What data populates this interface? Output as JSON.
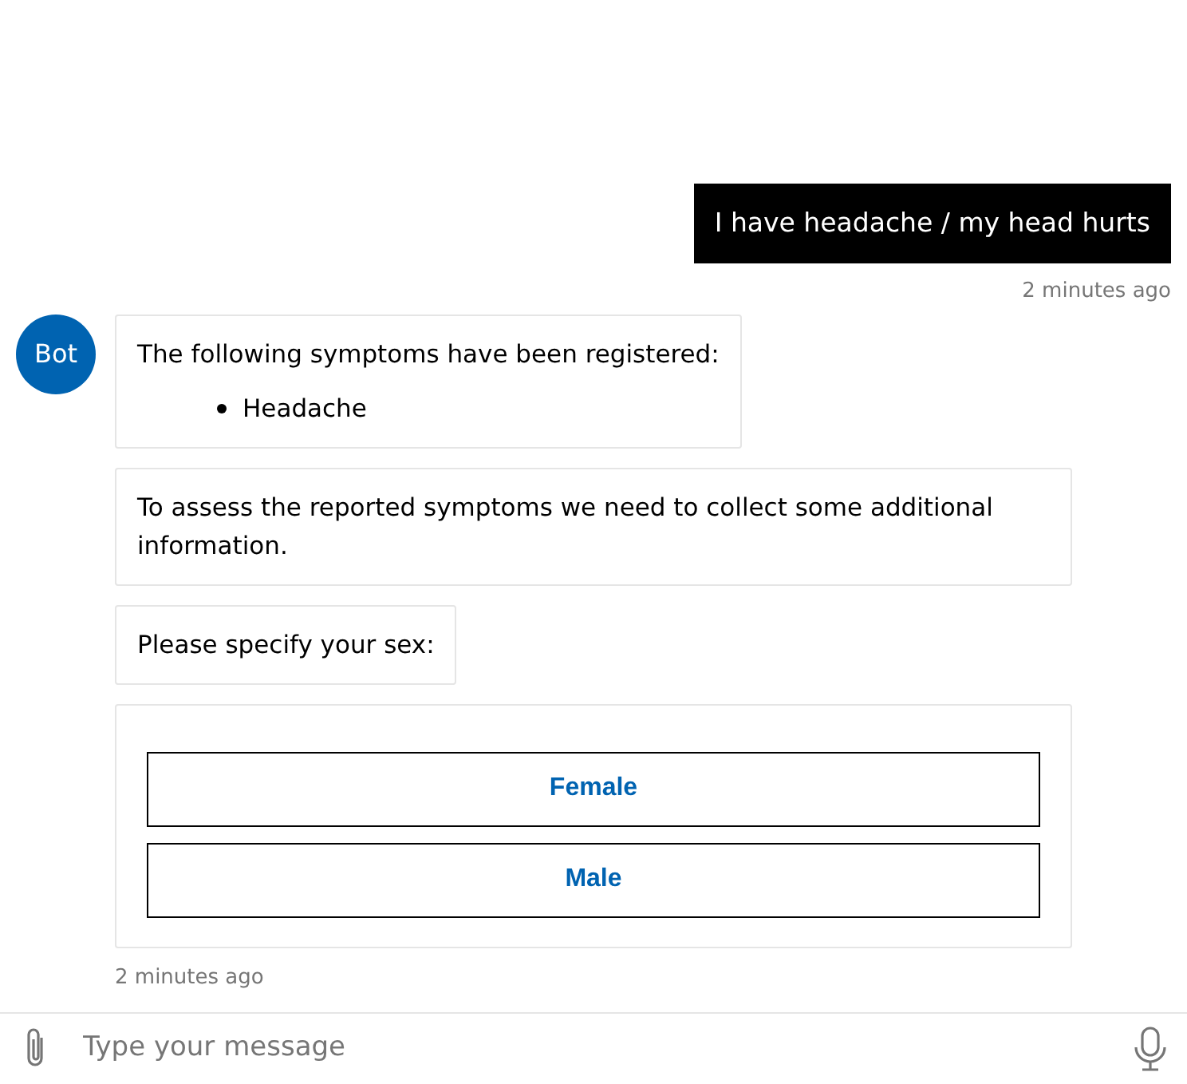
{
  "user_message": {
    "text": "I have headache / my head hurts",
    "timestamp": "2 minutes ago"
  },
  "bot": {
    "avatar_label": "Bot",
    "messages": [
      {
        "kind": "list",
        "text": "The following symptoms have been registered:",
        "items": [
          "Headache"
        ]
      },
      {
        "kind": "text",
        "text": "To assess the reported symptoms we need to collect some additional information."
      },
      {
        "kind": "text",
        "text": "Please specify your sex:"
      },
      {
        "kind": "card",
        "buttons": [
          "Female",
          "Male"
        ]
      }
    ],
    "timestamp": "2 minutes ago"
  },
  "composer": {
    "placeholder": "Type your message"
  }
}
